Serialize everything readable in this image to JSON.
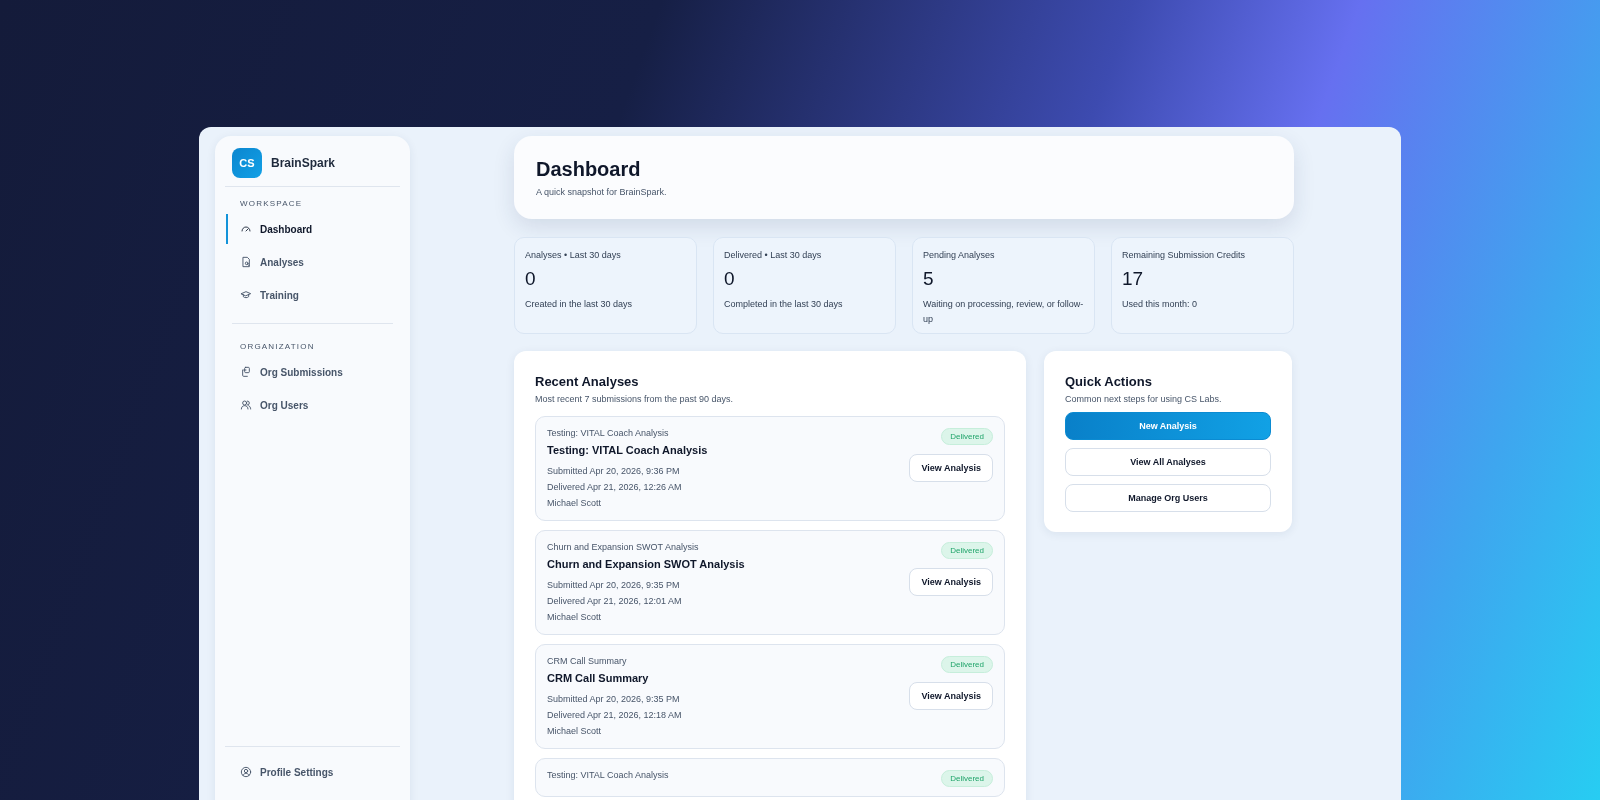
{
  "sidebar": {
    "logo": {
      "initials": "CS",
      "name": "BrainSpark"
    },
    "sections": [
      {
        "heading": "WORKSPACE",
        "items": [
          {
            "label": "Dashboard",
            "selected": true
          },
          {
            "label": "Analyses",
            "selected": false
          },
          {
            "label": "Training",
            "selected": false
          }
        ]
      },
      {
        "heading": "ORGANIZATION",
        "items": [
          {
            "label": "Org Submissions",
            "selected": false
          },
          {
            "label": "Org Users",
            "selected": false
          }
        ]
      }
    ],
    "footer": {
      "label": "Profile Settings",
      "selected": false
    }
  },
  "header": {
    "title": "Dashboard",
    "subtitle": "A quick snapshot for BrainSpark."
  },
  "stats": [
    {
      "label": "Analyses • Last 30 days",
      "value": "0",
      "note": "Created in the last 30 days"
    },
    {
      "label": "Delivered • Last 30 days",
      "value": "0",
      "note": "Completed in the last 30 days"
    },
    {
      "label": "Pending Analyses",
      "value": "5",
      "note": "Waiting on processing, review, or follow-up"
    },
    {
      "label": "Remaining Submission Credits",
      "value": "17",
      "note": "Used this month: 0"
    }
  ],
  "recent": {
    "title": "Recent Analyses",
    "subtitle": "Most recent 7 submissions from the past 90 days.",
    "items": [
      {
        "type_label": "Testing: VITAL Coach Analysis",
        "title": "Testing: VITAL Coach Analysis",
        "submitted": "Submitted Apr 20, 2026, 9:36 PM",
        "delivered": "Delivered Apr 21, 2026, 12:26 AM",
        "user": "Michael Scott",
        "status": "Delivered",
        "action": "View Analysis"
      },
      {
        "type_label": "Churn and Expansion SWOT Analysis",
        "title": "Churn and Expansion SWOT Analysis",
        "submitted": "Submitted Apr 20, 2026, 9:35 PM",
        "delivered": "Delivered Apr 21, 2026, 12:01 AM",
        "user": "Michael Scott",
        "status": "Delivered",
        "action": "View Analysis"
      },
      {
        "type_label": "CRM Call Summary",
        "title": "CRM Call Summary",
        "submitted": "Submitted Apr 20, 2026, 9:35 PM",
        "delivered": "Delivered Apr 21, 2026, 12:18 AM",
        "user": "Michael Scott",
        "status": "Delivered",
        "action": "View Analysis"
      },
      {
        "type_label": "Testing: VITAL Coach Analysis",
        "status": "Delivered"
      }
    ]
  },
  "quick_actions": {
    "title": "Quick Actions",
    "subtitle": "Common next steps for using CS Labs.",
    "buttons": [
      {
        "label": "New Analysis",
        "kind": "primary"
      },
      {
        "label": "View All Analyses",
        "kind": "secondary"
      },
      {
        "label": "Manage Org Users",
        "kind": "secondary"
      }
    ]
  }
}
